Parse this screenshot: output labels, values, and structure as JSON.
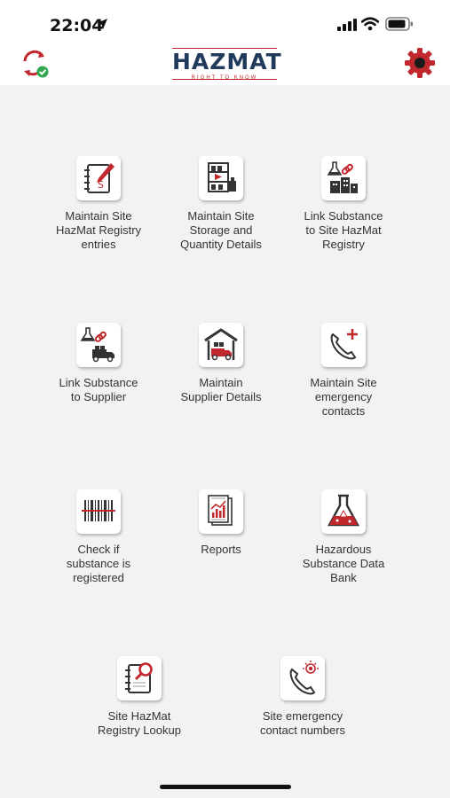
{
  "status_bar": {
    "time": "22:04"
  },
  "header": {
    "logo_text": "HAZMAT",
    "logo_tagline": "RIGHT TO KNOW"
  },
  "colors": {
    "accent_red": "#c0282d",
    "navy": "#1f3a5a",
    "background": "#f2f2f2"
  },
  "tiles": [
    {
      "label": "Maintain Site\nHazMat Registry\nentries",
      "icon": "notebook-pencil-icon"
    },
    {
      "label": "Maintain Site\nStorage and\nQuantity Details",
      "icon": "storage-shelf-icon"
    },
    {
      "label": "Link Substance\nto Site HazMat\nRegistry",
      "icon": "flask-link-building-icon"
    },
    {
      "label": "Link Substance\nto Supplier",
      "icon": "flask-link-truck-icon"
    },
    {
      "label": "Maintain\nSupplier Details",
      "icon": "warehouse-truck-icon"
    },
    {
      "label": "Maintain Site\nemergency\ncontacts",
      "icon": "phone-plus-icon"
    },
    {
      "label": "Check if\nsubstance is\nregistered",
      "icon": "barcode-icon"
    },
    {
      "label": "Reports",
      "icon": "report-chart-icon"
    },
    {
      "label": "Hazardous\nSubstance Data\nBank",
      "icon": "hazard-flask-icon"
    },
    {
      "label": "Site HazMat\nRegistry Lookup",
      "icon": "notebook-search-icon"
    },
    {
      "label": "Site emergency\ncontact numbers",
      "icon": "phone-alarm-icon"
    }
  ]
}
